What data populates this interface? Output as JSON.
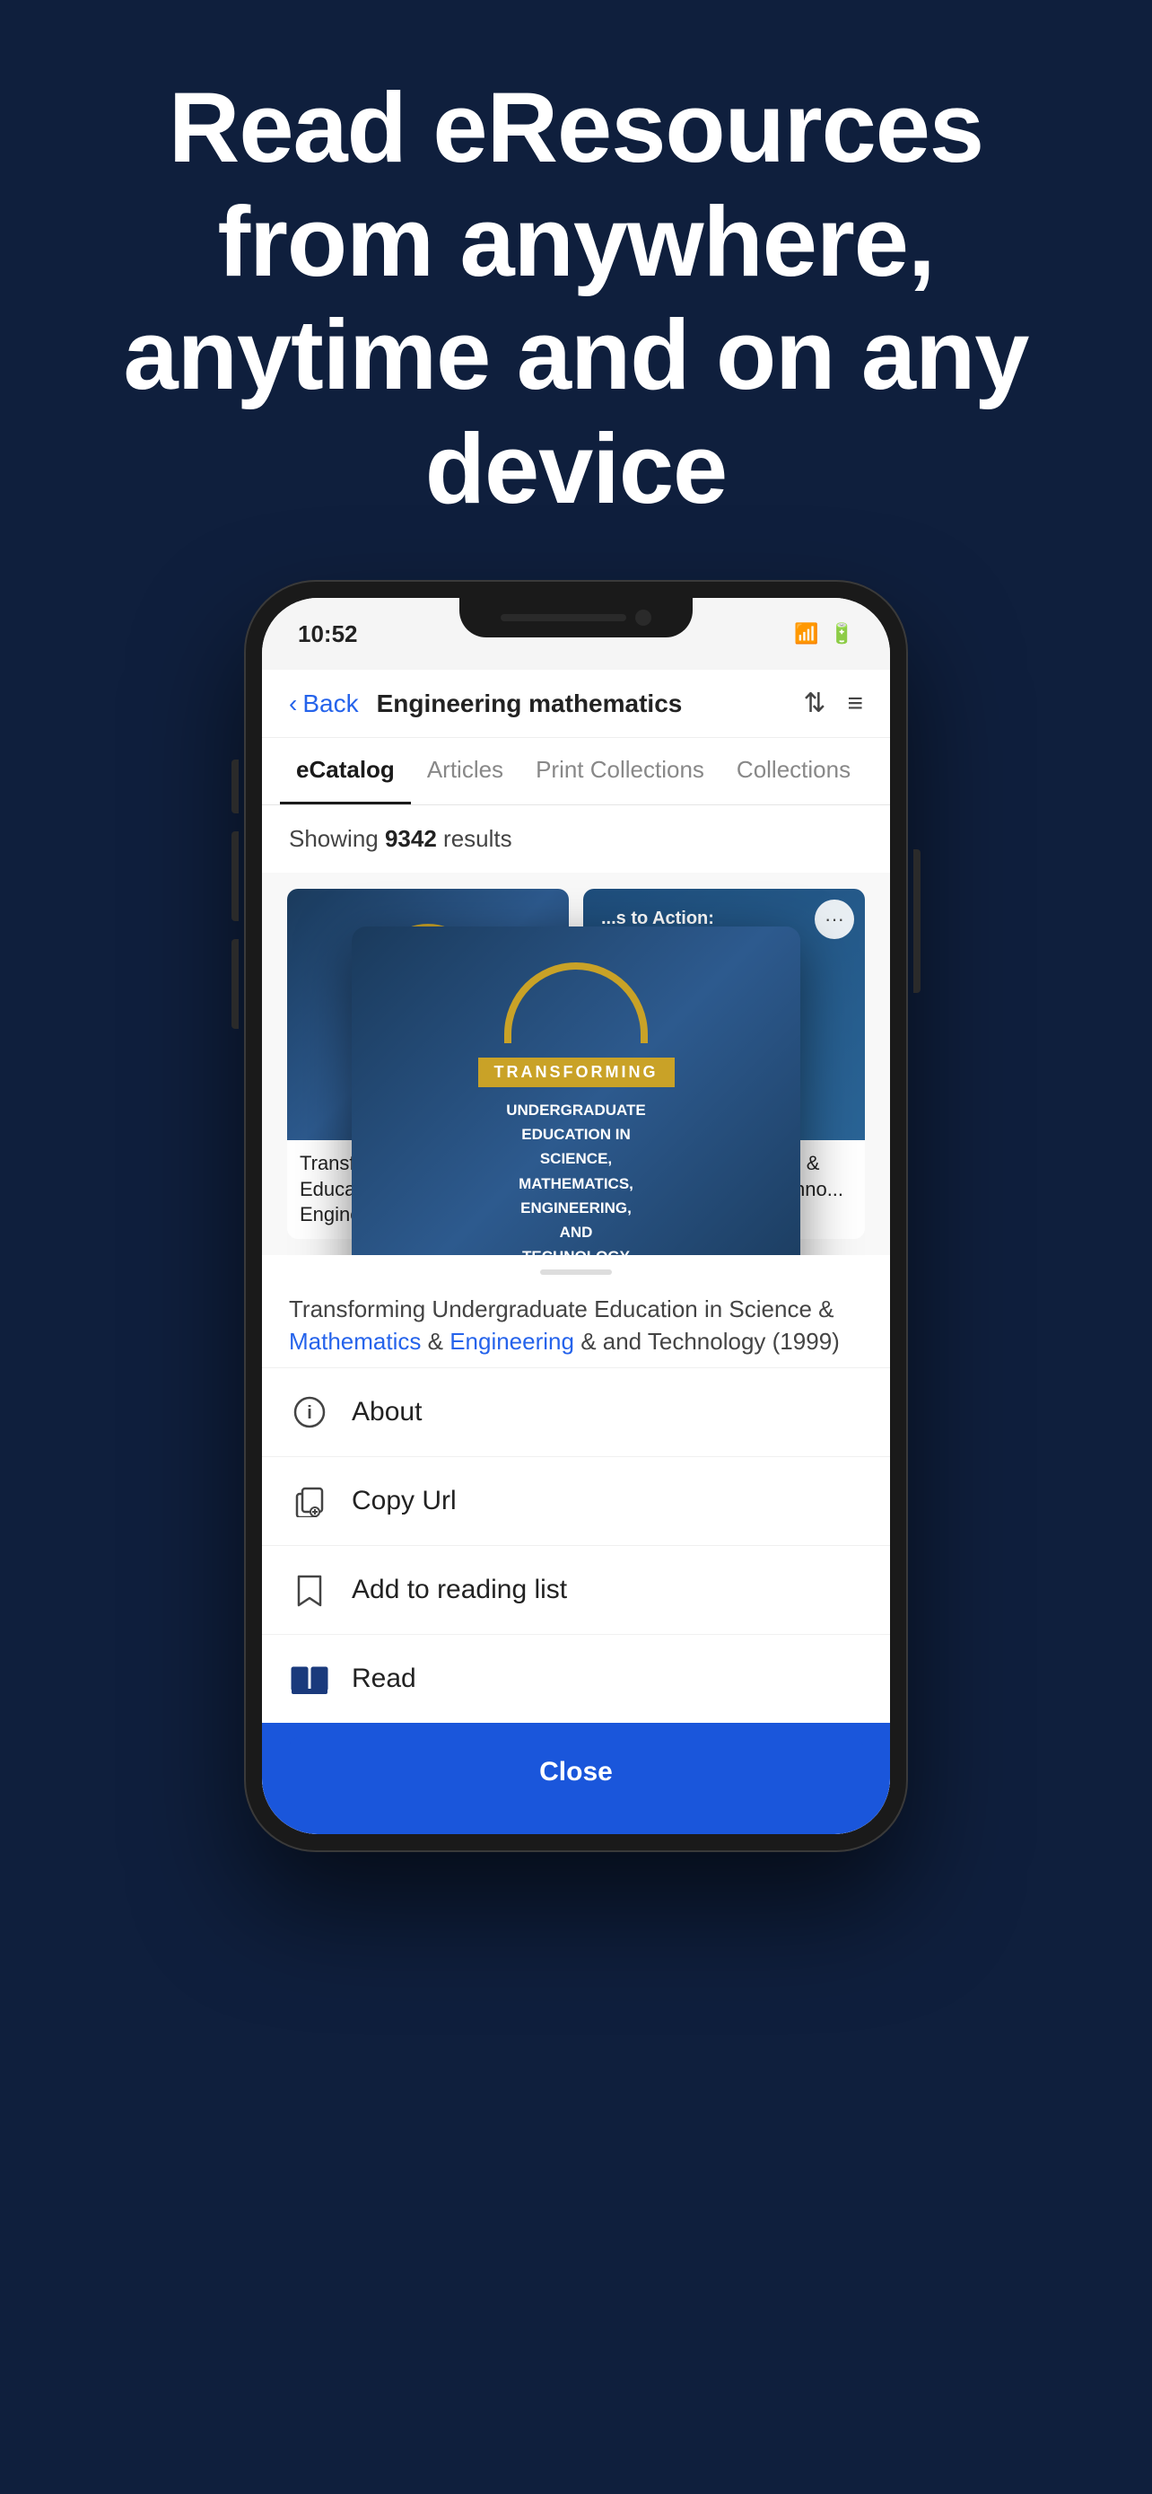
{
  "hero": {
    "title": "Read eResources from anywhere, anytime and on any device"
  },
  "phone": {
    "status": {
      "time": "10:52",
      "wifi": "wifi",
      "battery": "battery"
    }
  },
  "nav": {
    "back_label": "Back",
    "title": "Engineering mathematics",
    "sort_icon": "sort",
    "filter_icon": "filter"
  },
  "tabs": [
    {
      "label": "eCatalog",
      "active": true
    },
    {
      "label": "Articles",
      "active": false
    },
    {
      "label": "Print Collections",
      "active": false
    },
    {
      "label": "Collections",
      "active": false
    }
  ],
  "results": {
    "prefix": "Showing ",
    "count": "9342",
    "suffix": " results"
  },
  "books": [
    {
      "title": "Transforming Undergraduate Education in Mathematics, Engineering & and Techno..."
    },
    {
      "title": "... to Action: ce Science & Engineering & and Techno..."
    }
  ],
  "popup": {
    "label": "TRANSFORMING",
    "text": "UNDERGRADUATE\nEDUCATION IN\nSCIENCE,\nMATHEMATICS,\nENGINEERING,\nAND\nTECHNOLOGY"
  },
  "bottom_sheet": {
    "title_parts": [
      {
        "text": "Transforming Undergraduate Education in Science & ",
        "link": false
      },
      {
        "text": "Mathematics",
        "link": true
      },
      {
        "text": " & ",
        "link": false
      },
      {
        "text": "Engineering",
        "link": true
      },
      {
        "text": " & and Technology (1999)",
        "link": false
      }
    ],
    "items": [
      {
        "icon": "info",
        "label": "About"
      },
      {
        "icon": "copy-url",
        "label": "Copy Url"
      },
      {
        "icon": "bookmark",
        "label": "Add to reading list"
      },
      {
        "icon": "book-open",
        "label": "Read"
      }
    ],
    "close_label": "Close"
  }
}
